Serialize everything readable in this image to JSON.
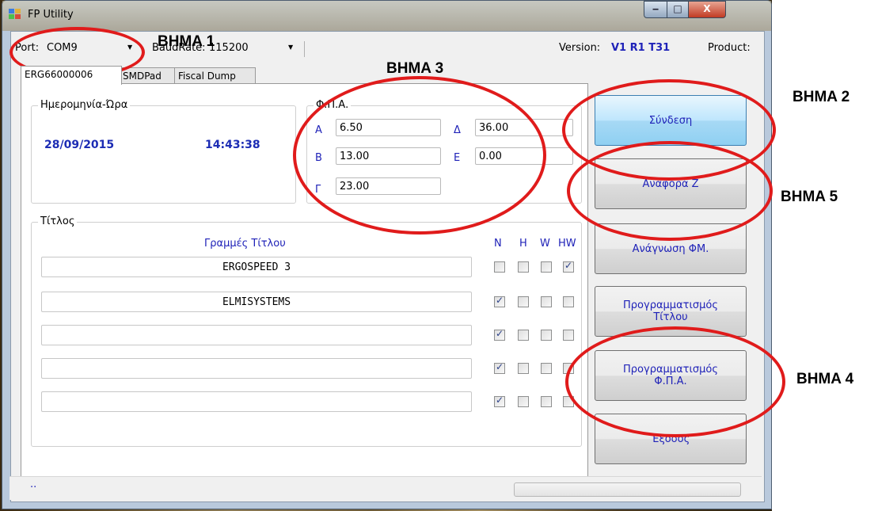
{
  "window": {
    "title": "FP Utility",
    "minimize": "‒",
    "maximize": "□",
    "close": "X"
  },
  "toolbar": {
    "port_label": "Port:",
    "port_value": "COM9",
    "baud_label": "BaudRate:",
    "baud_value": "115200",
    "version_label": "Version:",
    "version_value": "V1 R1 T31",
    "product_label": "Product:"
  },
  "tabs": [
    "ERG66000006",
    "SMDPad",
    "Fiscal Dump"
  ],
  "datetime": {
    "group_title": "Ημερομηνία-Ώρα",
    "date": "28/09/2015",
    "time": "14:43:38"
  },
  "vat": {
    "group_title": "Φ.Π.Α.",
    "rates": [
      {
        "letter": "Α",
        "value": "6.50"
      },
      {
        "letter": "Β",
        "value": "13.00"
      },
      {
        "letter": "Γ",
        "value": "23.00"
      },
      {
        "letter": "Δ",
        "value": "36.00"
      },
      {
        "letter": "Ε",
        "value": "0.00"
      }
    ]
  },
  "title_group": {
    "group_title": "Τίτλος",
    "lines_header": "Γραμμές Τίτλου",
    "flag_headers": [
      "N",
      "H",
      "W",
      "HW"
    ],
    "lines": [
      {
        "text": "ERGOSPEED 3",
        "flags": [
          false,
          false,
          false,
          true
        ]
      },
      {
        "text": "ELMISYSTEMS",
        "flags": [
          true,
          false,
          false,
          false
        ]
      },
      {
        "text": "",
        "flags": [
          true,
          false,
          false,
          false
        ]
      },
      {
        "text": "",
        "flags": [
          true,
          false,
          false,
          false
        ]
      },
      {
        "text": "",
        "flags": [
          true,
          false,
          false,
          false
        ]
      }
    ]
  },
  "buttons": {
    "connect": "Σύνδεση",
    "z_report": "Αναφορά Ζ",
    "fm_read": "Ανάγνωση ΦΜ.",
    "prog_title_1": "Προγραμματισμός",
    "prog_title_2": "Τίτλου",
    "prog_vat_1": "Προγραμματισμός",
    "prog_vat_2": "Φ.Π.Α.",
    "exit": "Έξοδος"
  },
  "status": {
    "text": "..",
    "progress": 0
  },
  "annotations": {
    "step1": "BHMA 1",
    "step2": "BHMA 2",
    "step3": "BHMA 3",
    "step4": "BHMA 4",
    "step5": "BHMA 5",
    "color": "#e01b1b"
  }
}
